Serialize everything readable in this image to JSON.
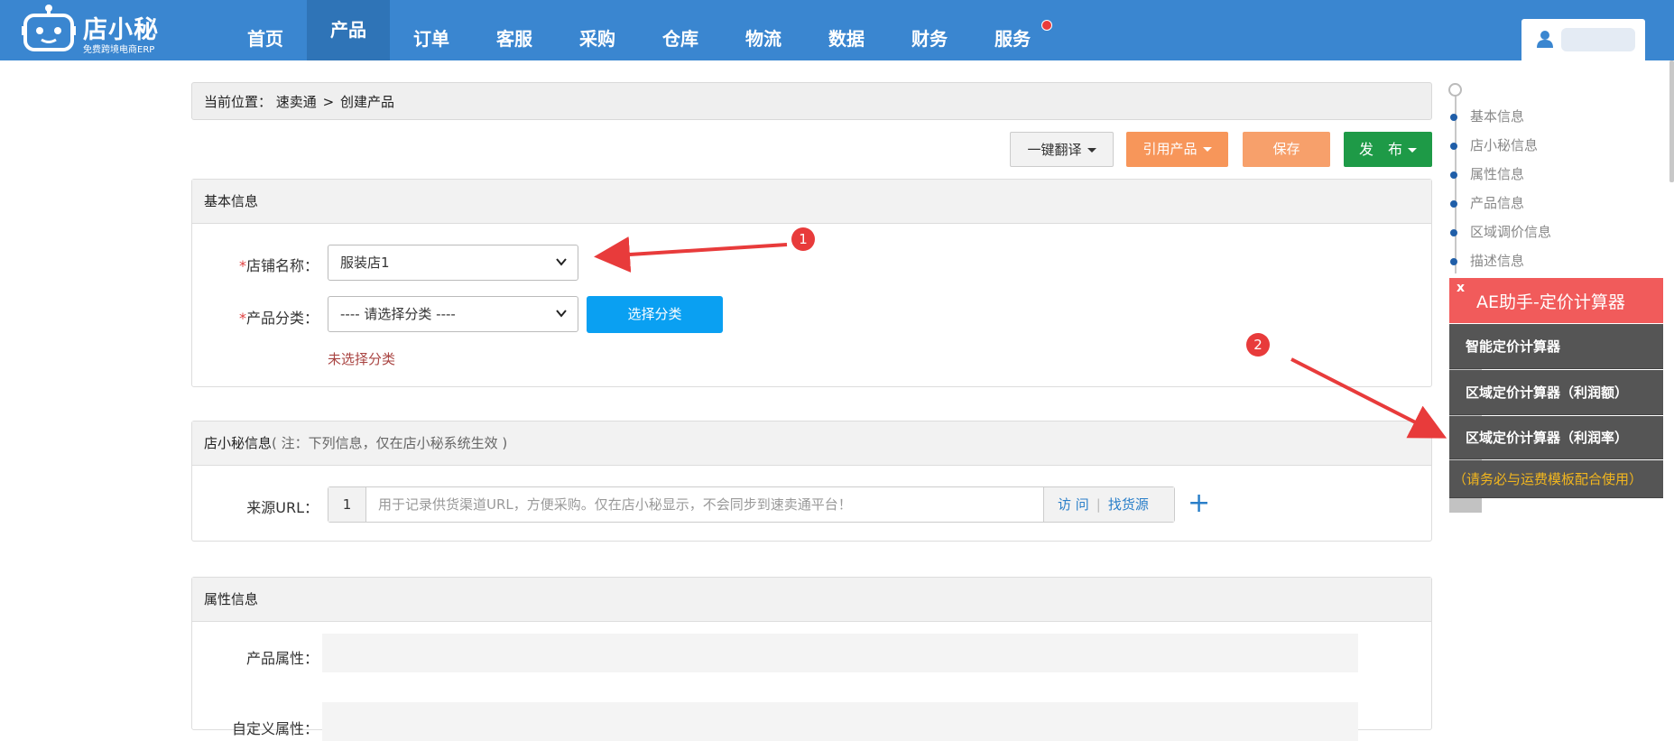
{
  "logo": {
    "name": "店小秘",
    "subtitle": "免费跨境电商ERP"
  },
  "nav": {
    "items": [
      {
        "label": "首页"
      },
      {
        "label": "产品",
        "active": true
      },
      {
        "label": "订单"
      },
      {
        "label": "客服"
      },
      {
        "label": "采购"
      },
      {
        "label": "仓库"
      },
      {
        "label": "物流"
      },
      {
        "label": "数据"
      },
      {
        "label": "财务"
      },
      {
        "label": "服务",
        "has_dot": true
      }
    ]
  },
  "breadcrumb": {
    "prefix": "当前位置：",
    "parent": "速卖通",
    "separator": ">",
    "current": "创建产品"
  },
  "toolbar": {
    "translate_label": "一键翻译",
    "cite_label": "引用产品",
    "save_label": "保存",
    "publish_label": "发　布"
  },
  "basic": {
    "title": "基本信息",
    "shop_label": "店铺名称：",
    "shop_value": "服装店1",
    "category_label": "产品分类：",
    "category_value": "---- 请选择分类 ----",
    "choose_button": "选择分类",
    "error": "未选择分类"
  },
  "dxm": {
    "title": "店小秘信息",
    "note": "( 注：下列信息，仅在店小秘系统生效 )",
    "url_label": "来源URL：",
    "url_index": "1",
    "url_placeholder": "用于记录供货渠道URL，方便采购。仅在店小秘显示，不会同步到速卖通平台！",
    "visit": "访 问",
    "find_source": "找货源",
    "plus": "+"
  },
  "attr": {
    "title": "属性信息",
    "product_attr_label": "产品属性：",
    "custom_attr_label": "自定义属性："
  },
  "side_nav": {
    "items": [
      "基本信息",
      "店小秘信息",
      "属性信息",
      "产品信息",
      "区域调价信息",
      "描述信息"
    ]
  },
  "ae_helper": {
    "close": "x",
    "title": "AE助手-定价计算器",
    "items": [
      "智能定价计算器",
      "区域定价计算器（利润额）",
      "区域定价计算器（利润率）"
    ],
    "notice": "（请务必与运费模板配合使用）"
  },
  "annotations": {
    "first": "1",
    "second": "2"
  },
  "colors": {
    "nav": "#3a86d0",
    "primary": "#0aa0f2",
    "orange": "#f7965a",
    "green": "#1e9a47",
    "helper_red": "#f15b5b",
    "annotation_red": "#e83b3b"
  }
}
